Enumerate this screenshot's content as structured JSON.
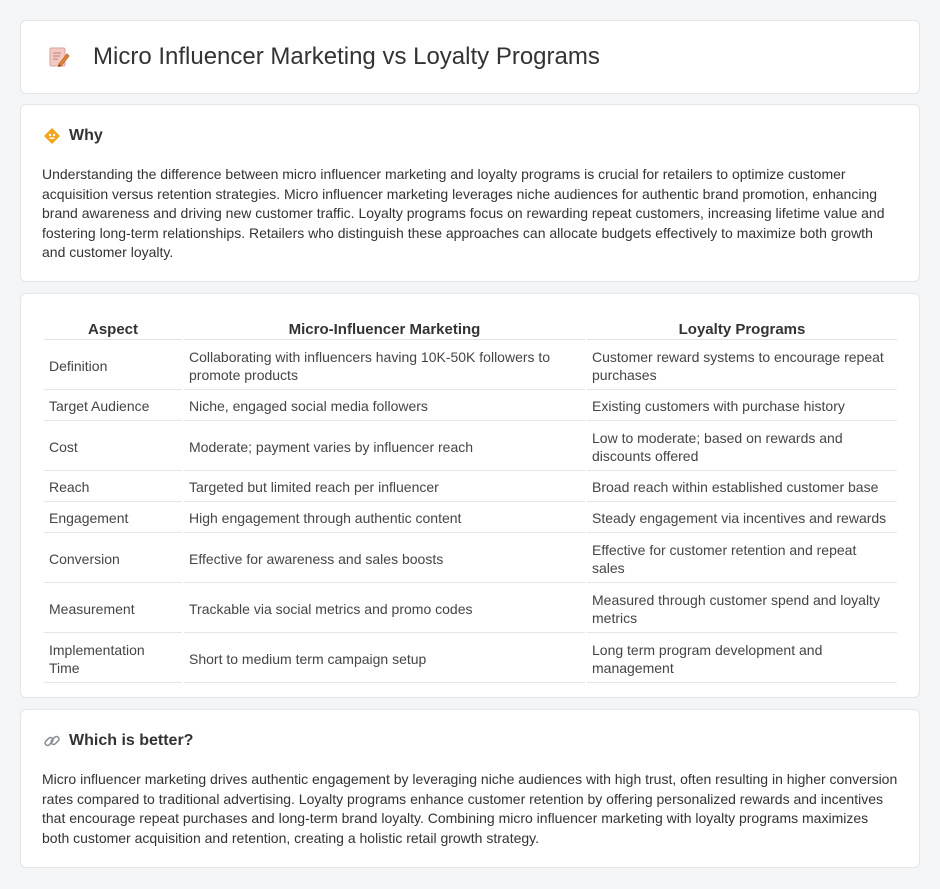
{
  "header": {
    "title": "Micro Influencer Marketing vs Loyalty Programs",
    "icon": "document-edit-icon"
  },
  "why": {
    "title": "Why",
    "icon": "lightbulb-icon",
    "text": "Understanding the difference between micro influencer marketing and loyalty programs is crucial for retailers to optimize customer acquisition versus retention strategies. Micro influencer marketing leverages niche audiences for authentic brand promotion, enhancing brand awareness and driving new customer traffic. Loyalty programs focus on rewarding repeat customers, increasing lifetime value and fostering long-term relationships. Retailers who distinguish these approaches can allocate budgets effectively to maximize both growth and customer loyalty."
  },
  "table": {
    "headers": [
      "Aspect",
      "Micro-Influencer Marketing",
      "Loyalty Programs"
    ],
    "rows": [
      [
        "Definition",
        "Collaborating with influencers having 10K-50K followers to promote products",
        "Customer reward systems to encourage repeat purchases"
      ],
      [
        "Target Audience",
        "Niche, engaged social media followers",
        "Existing customers with purchase history"
      ],
      [
        "Cost",
        "Moderate; payment varies by influencer reach",
        "Low to moderate; based on rewards and discounts offered"
      ],
      [
        "Reach",
        "Targeted but limited reach per influencer",
        "Broad reach within established customer base"
      ],
      [
        "Engagement",
        "High engagement through authentic content",
        "Steady engagement via incentives and rewards"
      ],
      [
        "Conversion",
        "Effective for awareness and sales boosts",
        "Effective for customer retention and repeat sales"
      ],
      [
        "Measurement",
        "Trackable via social metrics and promo codes",
        "Measured through customer spend and loyalty metrics"
      ],
      [
        "Implementation Time",
        "Short to medium term campaign setup",
        "Long term program development and management"
      ]
    ]
  },
  "better": {
    "title": "Which is better?",
    "icon": "link-icon",
    "text": "Micro influencer marketing drives authentic engagement by leveraging niche audiences with high trust, often resulting in higher conversion rates compared to traditional advertising. Loyalty programs enhance customer retention by offering personalized rewards and incentives that encourage repeat purchases and long-term brand loyalty. Combining micro influencer marketing with loyalty programs maximizes both customer acquisition and retention, creating a holistic retail growth strategy."
  }
}
